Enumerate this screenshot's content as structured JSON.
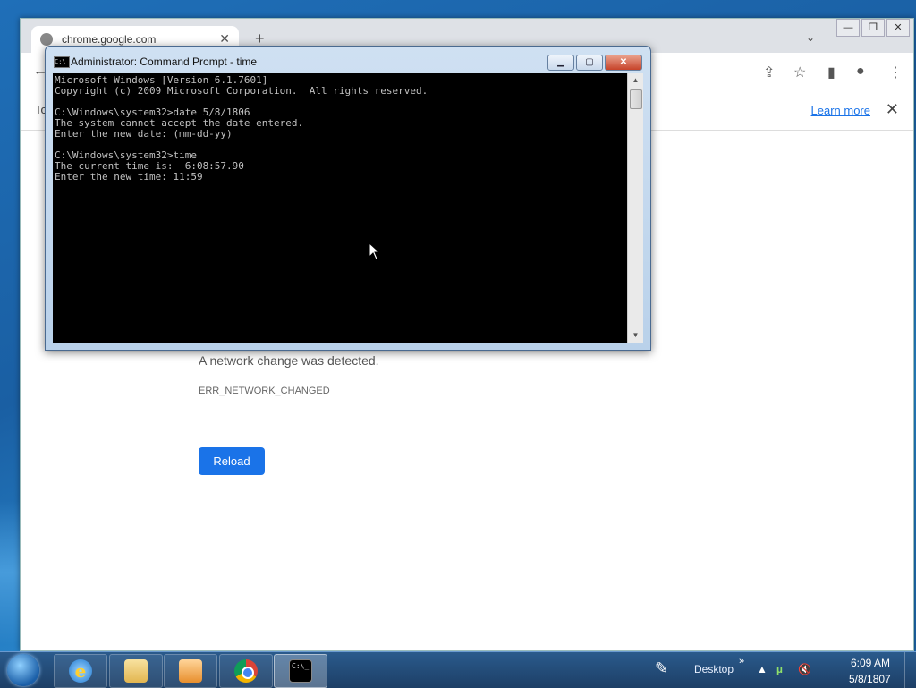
{
  "chrome": {
    "tab_title": "chrome.google.com",
    "tab_close": "✕",
    "new_tab": "+",
    "tab_search": "⌄",
    "win_min": "—",
    "win_max": "❐",
    "win_close": "✕",
    "infobar_prefix": "To",
    "learn_more": "Learn more",
    "infobar_close": "✕",
    "error_message": "A network change was detected.",
    "error_code": "ERR_NETWORK_CHANGED",
    "reload_label": "Reload"
  },
  "cmd": {
    "title": "Administrator: Command Prompt - time",
    "icon_text": "C:\\",
    "min": "▁",
    "max": "▢",
    "close": "✕",
    "lines": [
      "Microsoft Windows [Version 6.1.7601]",
      "Copyright (c) 2009 Microsoft Corporation.  All rights reserved.",
      "",
      "C:\\Windows\\system32>date 5/8/1806",
      "The system cannot accept the date entered.",
      "Enter the new date: (mm-dd-yy)",
      "",
      "C:\\Windows\\system32>time",
      "The current time is:  6:08:57.90",
      "Enter the new time: 11:59"
    ]
  },
  "taskbar": {
    "desktop_label": "Desktop",
    "chevron": "»",
    "clock_time": "6:09 AM",
    "clock_date": "5/8/1807",
    "ie_glyph": "e",
    "cmd_glyph": "C:\\_"
  }
}
